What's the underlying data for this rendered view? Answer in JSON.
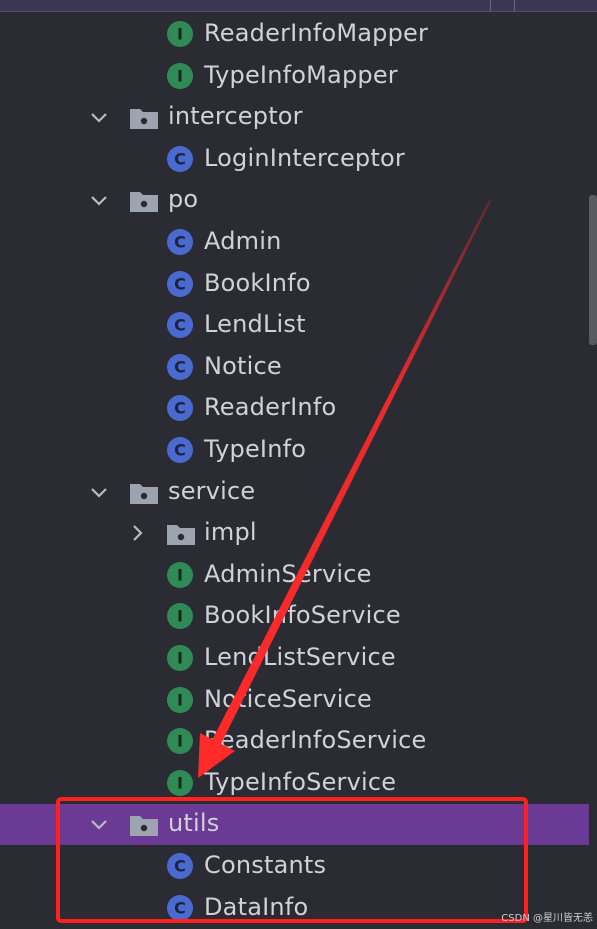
{
  "tree": [
    {
      "type": "interface",
      "label": "ReaderInfoMapper",
      "depth": 2
    },
    {
      "type": "interface",
      "label": "TypeInfoMapper",
      "depth": 2
    },
    {
      "type": "folder",
      "label": "interceptor",
      "depth": 1,
      "expanded": true
    },
    {
      "type": "class",
      "label": "LoginInterceptor",
      "depth": 2
    },
    {
      "type": "folder",
      "label": "po",
      "depth": 1,
      "expanded": true
    },
    {
      "type": "class",
      "label": "Admin",
      "depth": 2
    },
    {
      "type": "class",
      "label": "BookInfo",
      "depth": 2
    },
    {
      "type": "class",
      "label": "LendList",
      "depth": 2
    },
    {
      "type": "class",
      "label": "Notice",
      "depth": 2
    },
    {
      "type": "class",
      "label": "ReaderInfo",
      "depth": 2
    },
    {
      "type": "class",
      "label": "TypeInfo",
      "depth": 2
    },
    {
      "type": "folder",
      "label": "service",
      "depth": 1,
      "expanded": true
    },
    {
      "type": "folder",
      "label": "impl",
      "depth": 2,
      "expanded": false
    },
    {
      "type": "interface",
      "label": "AdminService",
      "depth": 2
    },
    {
      "type": "interface",
      "label": "BookInfoService",
      "depth": 2
    },
    {
      "type": "interface",
      "label": "LendListService",
      "depth": 2
    },
    {
      "type": "interface",
      "label": "NoticeService",
      "depth": 2
    },
    {
      "type": "interface",
      "label": "ReaderInfoService",
      "depth": 2
    },
    {
      "type": "interface",
      "label": "TypeInfoService",
      "depth": 2
    },
    {
      "type": "folder",
      "label": "utils",
      "depth": 1,
      "expanded": true,
      "selected": true
    },
    {
      "type": "class",
      "label": "Constants",
      "depth": 2
    },
    {
      "type": "class",
      "label": "DataInfo",
      "depth": 2
    }
  ],
  "icons": {
    "class_letter": "C",
    "interface_letter": "I"
  },
  "colors": {
    "background": "#2b2b33",
    "selection": "#6b3a94",
    "class_icon": "#4a6ad0",
    "interface_icon": "#2f8a55",
    "folder_icon": "#9ea3b0",
    "annotation": "#ff2a2a"
  },
  "watermark": "CSDN @星川皆无恙"
}
